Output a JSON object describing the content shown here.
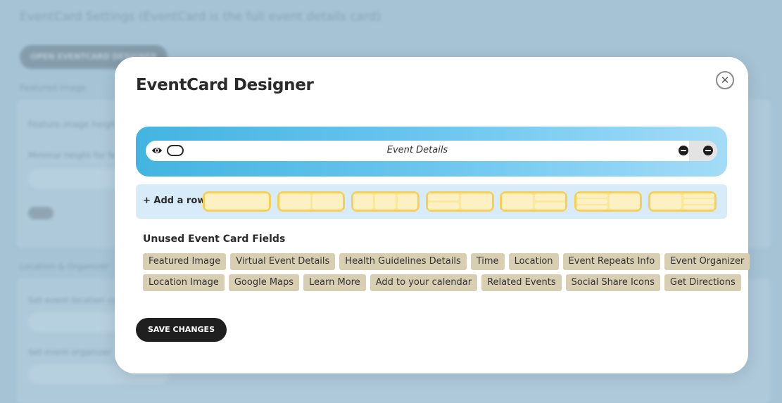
{
  "background": {
    "title": "EventCard Settings (EventCard is the full event details card)",
    "button_label": "OPEN EVENTCARD DESIGNER",
    "featured_label": "Featured Image",
    "feature_field_label": "Feature image height",
    "min_height_label": "Minimal height for fe",
    "location_label": "Location & Organizer",
    "set_location_label": "Set event location ca",
    "set_organizer_label": "Set event organizer"
  },
  "modal": {
    "title": "EventCard Designer",
    "close_symbol": "✕",
    "designer_row": {
      "field_label": "Event Details"
    },
    "add_row": {
      "label": "+ Add a row"
    },
    "unused": {
      "title": "Unused Event Card Fields",
      "row1": [
        "Featured Image",
        "Virtual Event Details",
        "Health Guidelines Details",
        "Time",
        "Location",
        "Event Repeats Info",
        "Event Organizer"
      ],
      "row2": [
        "Location Image",
        "Google Maps",
        "Learn More",
        "Add to your calendar",
        "Related Events",
        "Social Share Icons",
        "Get Directions"
      ]
    },
    "save_label": "SAVE CHANGES"
  },
  "colors": {
    "accent_gradient_start": "#43b4e0",
    "accent_gradient_end": "#a3dcf7",
    "layout_border": "#f8cf55",
    "chip_bg": "#d8cfb3",
    "save_bg": "#1f1f1f"
  }
}
